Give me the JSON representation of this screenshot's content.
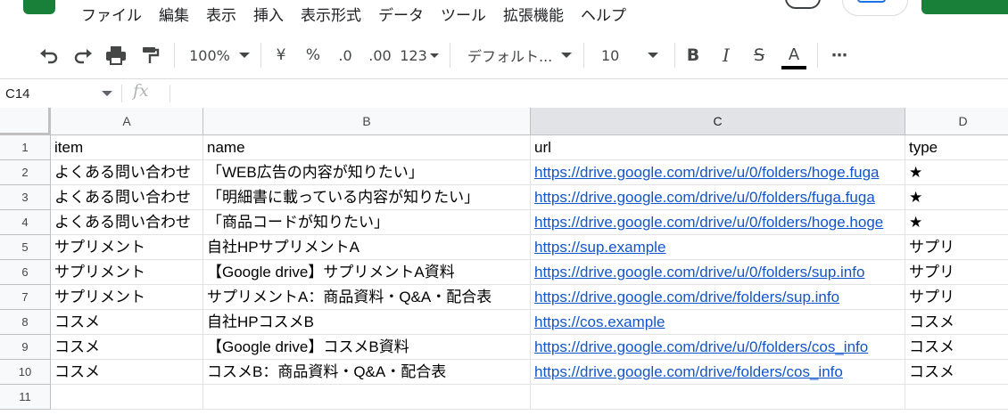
{
  "menu": [
    "ファイル",
    "編集",
    "表示",
    "挿入",
    "表示形式",
    "データ",
    "ツール",
    "拡張機能",
    "ヘルプ"
  ],
  "toolbar": {
    "zoom": "100%",
    "currency": "¥",
    "percent": "%",
    "decrease_decimal": ".0",
    "increase_decimal": ".00",
    "number_format": "123",
    "font": "デフォルト...",
    "font_size": "10",
    "bold": "B",
    "italic": "I",
    "strikethrough": "S",
    "text_color": "A",
    "more": "⋯"
  },
  "formula_bar": {
    "name_box": "C14",
    "fx": "fx",
    "value": ""
  },
  "columns": [
    "A",
    "B",
    "C",
    "D"
  ],
  "rows": [
    {
      "num": "1",
      "cells": [
        "item",
        "name",
        "url",
        "type"
      ]
    },
    {
      "num": "2",
      "cells": [
        "よくある問い合わせ",
        "「WEB広告の内容が知りたい」",
        "https://drive.google.com/drive/u/0/folders/hoge.fuga",
        "★"
      ]
    },
    {
      "num": "3",
      "cells": [
        "よくある問い合わせ",
        "「明細書に載っている内容が知りたい」",
        "https://drive.google.com/drive/u/0/folders/fuga.fuga",
        "★"
      ]
    },
    {
      "num": "4",
      "cells": [
        "よくある問い合わせ",
        "「商品コードが知りたい」",
        "https://drive.google.com/drive/u/0/folders/hoge.hoge",
        "★"
      ]
    },
    {
      "num": "5",
      "cells": [
        "サプリメント",
        "自社HPサプリメントA",
        "https://sup.example",
        "サプリ"
      ]
    },
    {
      "num": "6",
      "cells": [
        "サプリメント",
        "【Google drive】サプリメントA資料",
        "https://drive.google.com/drive/u/0/folders/sup.info",
        "サプリ"
      ]
    },
    {
      "num": "7",
      "cells": [
        "サプリメント",
        "サプリメントA：商品資料・Q&A・配合表",
        "https://drive.google.com/drive/folders/sup.info",
        "サプリ"
      ]
    },
    {
      "num": "8",
      "cells": [
        "コスメ",
        "自社HPコスメB",
        "https://cos.example",
        "コスメ"
      ]
    },
    {
      "num": "9",
      "cells": [
        "コスメ",
        "【Google drive】コスメB資料",
        "https://drive.google.com/drive/u/0/folders/cos_info",
        "コスメ"
      ]
    },
    {
      "num": "10",
      "cells": [
        "コスメ",
        "コスメB：商品資料・Q&A・配合表",
        "https://drive.google.com/drive/folders/cos_info",
        "コスメ"
      ]
    },
    {
      "num": "11",
      "cells": [
        "",
        "",
        "",
        ""
      ]
    }
  ],
  "colors": {
    "link": "#1155cc",
    "header_bg": "#f8f9fa",
    "active_header_bg": "#e1e3e6",
    "brand_green": "#188038"
  }
}
